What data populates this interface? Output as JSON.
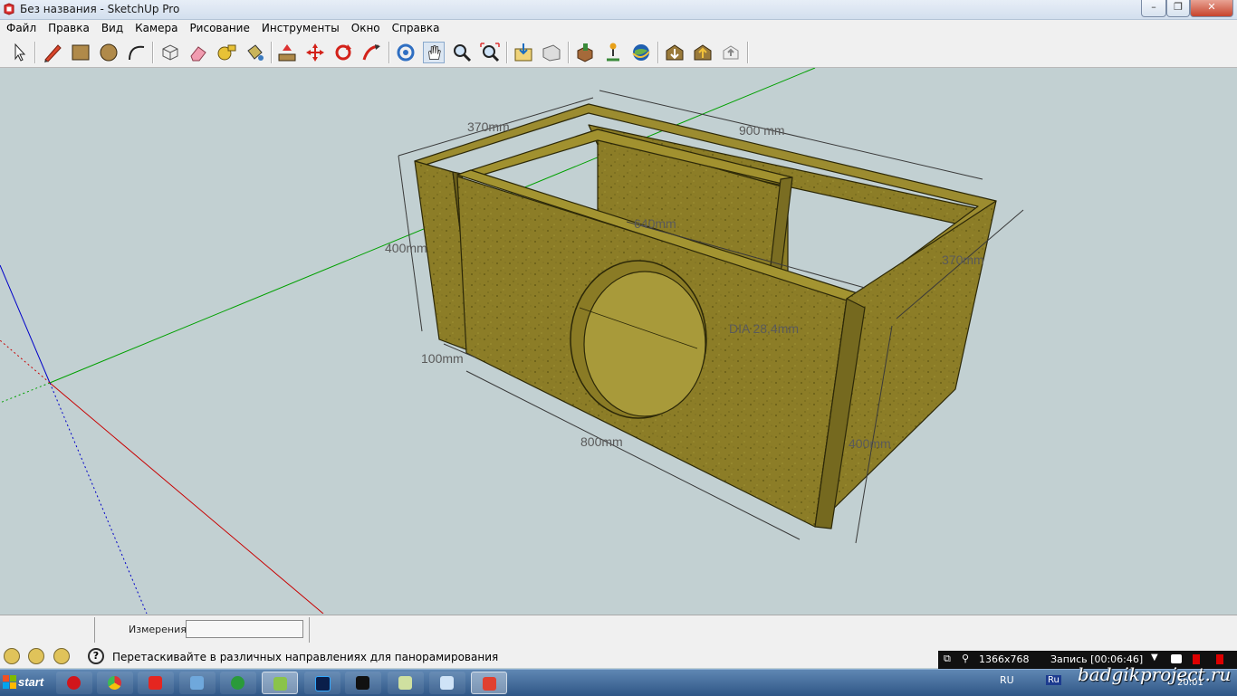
{
  "window": {
    "title": "Без названия - SketchUp Pro",
    "minimize": "–",
    "maximize": "❐",
    "close": "✕"
  },
  "menu": [
    "Файл",
    "Правка",
    "Вид",
    "Камера",
    "Рисование",
    "Инструменты",
    "Окно",
    "Справка"
  ],
  "toolbar": {
    "tools": [
      "select-icon",
      "pencil-line-icon",
      "rectangle-icon",
      "circle-icon",
      "arc-icon",
      "make-component-icon",
      "eraser-icon",
      "tape-measure-icon",
      "paint-bucket-icon",
      "push-pull-icon",
      "move-icon",
      "rotate-icon",
      "follow-me-icon",
      "orbit-icon",
      "pan-icon",
      "zoom-icon",
      "zoom-extents-icon",
      "get-models-icon",
      "share-model-icon",
      "place-model-icon",
      "get-models-pin-icon",
      "google-earth-icon",
      "warehouse-get-icon",
      "warehouse-share-icon",
      "extension-warehouse-icon"
    ]
  },
  "viewport": {
    "dimensions": {
      "d_370_top": "370mm",
      "d_900": "900 mm",
      "d_640": "640mm",
      "d_400_left": "400mm",
      "d_370_right": "370mm",
      "d_dia": "DIA 28,4mm",
      "d_100": "100mm",
      "d_800": "800mm",
      "d_400_right": "400mm"
    },
    "colors": {
      "background": "#c2d0d2",
      "wood": "#8c7d27",
      "axis_red": "#c80000",
      "axis_green": "#00a000",
      "axis_blue": "#0000c8"
    }
  },
  "measurements": {
    "label": "Измерения",
    "value": ""
  },
  "status": {
    "text": "Перетаскивайте в различных направлениях для панорамирования",
    "help": "?"
  },
  "recorder": {
    "resolution": "1366x768",
    "status": "Запись [00:06:46]"
  },
  "taskbar": {
    "start": "start",
    "apps": [
      "opera-icon",
      "chrome-icon",
      "yandex-icon",
      "remote-icon",
      "utorrent-icon",
      "notepadpp-icon",
      "photoshop-icon",
      "media-icon",
      "folder-icon",
      "notepad-icon",
      "sketchup-icon"
    ],
    "lang1": "RU",
    "lang2": "Ru",
    "watermark": "badgikproject.ru",
    "clock": "20:01"
  }
}
